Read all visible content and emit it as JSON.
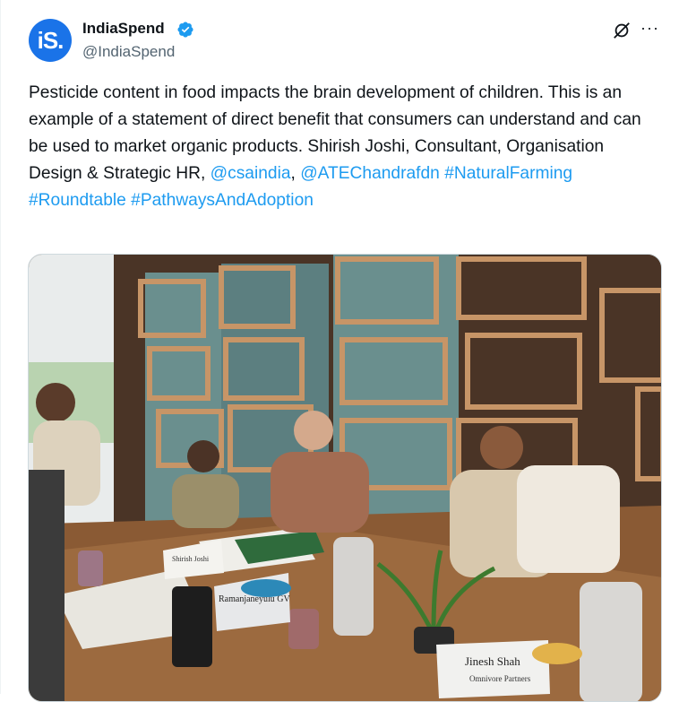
{
  "author": {
    "name": "IndiaSpend",
    "handle": "@IndiaSpend",
    "avatar_text": "iS.",
    "verified": true,
    "brand_color": "#1a73e8",
    "verified_color": "#1d9bf0"
  },
  "actions": {
    "grok_icon": "grok-icon",
    "more_icon": "more-options-icon",
    "more_label": "···"
  },
  "tweet": {
    "text_segments": [
      {
        "type": "text",
        "value": "Pesticide content in food impacts the brain development of children. This is an example of a statement of direct benefit that consumers can understand and can be used to market organic products. Shirish Joshi, Consultant, Organisation Design & Strategic HR, "
      },
      {
        "type": "mention",
        "value": "@csaindia"
      },
      {
        "type": "text",
        "value": ", "
      },
      {
        "type": "mention",
        "value": "@ATEChandrafdn"
      },
      {
        "type": "text",
        "value": " "
      },
      {
        "type": "hashtag",
        "value": "#NaturalFarming"
      },
      {
        "type": "text",
        "value": " "
      },
      {
        "type": "hashtag",
        "value": "#Roundtable"
      },
      {
        "type": "text",
        "value": " "
      },
      {
        "type": "hashtag",
        "value": "#PathwaysAndAdoption"
      }
    ],
    "link_color": "#1d9bf0"
  },
  "photo": {
    "name_cards": [
      "Shirish Joshi",
      "Ramanjaneyulu GV",
      "Jinesh Shah"
    ],
    "card_subtitles": [
      "Consultant, Organisation Design & Strategic HR",
      "Centre for Sustainable Agriculture",
      "Omnivore Partners"
    ]
  }
}
